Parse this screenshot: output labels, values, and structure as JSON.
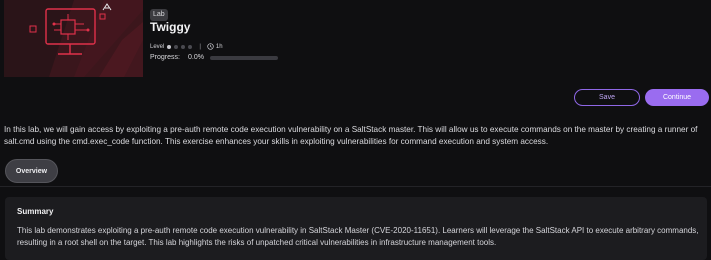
{
  "badge": "Lab",
  "title": "Twiggy",
  "level_label": "Level",
  "level": {
    "filled": 1,
    "total": 4
  },
  "duration": "1h",
  "progress": {
    "label": "Progress:",
    "text": "0.0%",
    "value": 0.0
  },
  "actions": {
    "save": "Save",
    "continue": "Continue"
  },
  "description": "In this lab, we will gain access by exploiting a pre-auth remote code execution vulnerability on a SaltStack master. This will allow us to execute commands on the master by creating a runner of salt.cmd using the cmd.exec_code function. This exercise enhances your skills in exploiting vulnerabilities for command execution and system access.",
  "tabs": [
    {
      "label": "Overview",
      "active": true
    }
  ],
  "summary": {
    "title": "Summary",
    "text": "This lab demonstrates exploiting a pre-auth remote code execution vulnerability in SaltStack Master (CVE-2020-11651). Learners will leverage the SaltStack API to execute arbitrary commands, resulting in a root shell on the target. This lab highlights the risks of unpatched critical vulnerabilities in infrastructure management tools."
  },
  "colors": {
    "accent": "#9a6cf0",
    "banner_bg": "#2a1418",
    "banner_stroke": "#e0314a"
  },
  "icons": {
    "banner": "monitor-circuit-icon",
    "os": "linux-icon",
    "duration": "clock-icon"
  }
}
